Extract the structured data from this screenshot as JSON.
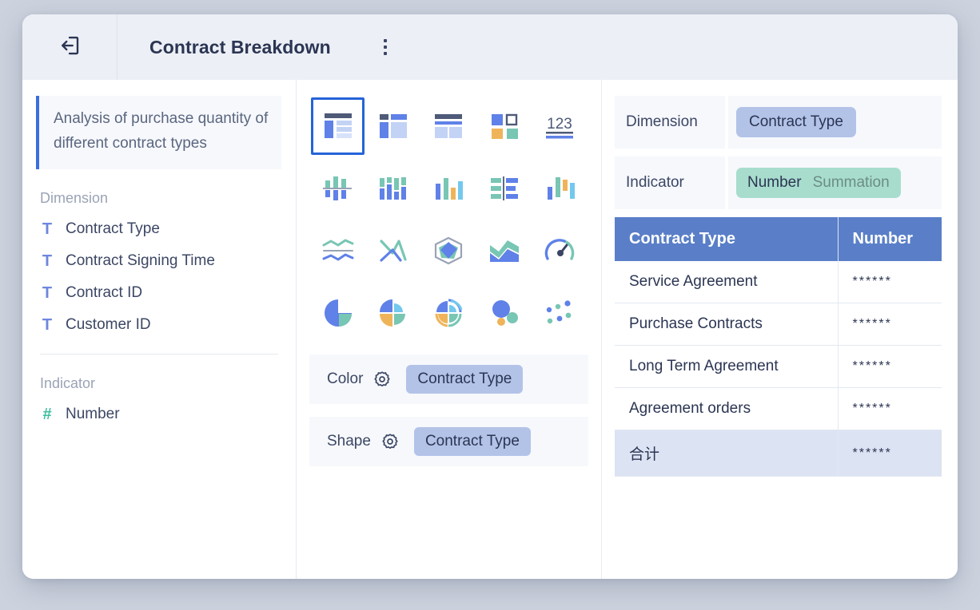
{
  "header": {
    "exit_icon": "exit-arrow-icon",
    "title": "Contract Breakdown",
    "menu_icon": "kebab-menu-icon"
  },
  "sidebar": {
    "description": "Analysis of purchase quantity of different contract types",
    "dimension_group_label": "Dimension",
    "dimension_fields": [
      {
        "icon": "text-type-icon",
        "glyph": "T",
        "label": "Contract Type"
      },
      {
        "icon": "text-type-icon",
        "glyph": "T",
        "label": "Contract Signing Time"
      },
      {
        "icon": "text-type-icon",
        "glyph": "T",
        "label": "Contract ID"
      },
      {
        "icon": "text-type-icon",
        "glyph": "T",
        "label": "Customer ID"
      }
    ],
    "indicator_group_label": "Indicator",
    "indicator_fields": [
      {
        "icon": "number-type-icon",
        "glyph": "#",
        "label": "Number"
      }
    ]
  },
  "chart_types": [
    {
      "name": "table-chart-icon",
      "selected": true
    },
    {
      "name": "pivot-table-chart-icon",
      "selected": false
    },
    {
      "name": "cross-table-chart-icon",
      "selected": false
    },
    {
      "name": "card-tile-chart-icon",
      "selected": false
    },
    {
      "name": "number-123-chart-icon",
      "selected": false
    },
    {
      "name": "bidirectional-bar-chart-icon",
      "selected": false
    },
    {
      "name": "waterfall-bar-chart-icon",
      "selected": false
    },
    {
      "name": "column-chart-icon",
      "selected": false
    },
    {
      "name": "horizontal-bar-chart-icon",
      "selected": false
    },
    {
      "name": "floating-bar-chart-icon",
      "selected": false
    },
    {
      "name": "multi-line-chart-icon",
      "selected": false
    },
    {
      "name": "dual-axis-line-chart-icon",
      "selected": false
    },
    {
      "name": "radar-chart-icon",
      "selected": false
    },
    {
      "name": "area-chart-icon",
      "selected": false
    },
    {
      "name": "gauge-chart-icon",
      "selected": false
    },
    {
      "name": "pie-chart-icon",
      "selected": false
    },
    {
      "name": "donut-segment-chart-icon",
      "selected": false
    },
    {
      "name": "rose-polar-chart-icon",
      "selected": false
    },
    {
      "name": "bubble-chart-icon",
      "selected": false
    },
    {
      "name": "scatter-chart-icon",
      "selected": false
    }
  ],
  "encodings": [
    {
      "label": "Color",
      "gear_icon": "gear-icon",
      "value": "Contract Type"
    },
    {
      "label": "Shape",
      "gear_icon": "gear-icon",
      "value": "Contract Type"
    }
  ],
  "slots": {
    "dimension": {
      "label": "Dimension",
      "value": "Contract Type"
    },
    "indicator": {
      "label": "Indicator",
      "value": "Number",
      "aggregation": "Summation"
    }
  },
  "chart_data": {
    "type": "table",
    "title": "Contract Breakdown",
    "columns": [
      "Contract Type",
      "Number"
    ],
    "categories": [
      "Service Agreement",
      "Purchase Contracts",
      "Long Term Agreement",
      "Agreement orders"
    ],
    "values": [
      "******",
      "******",
      "******",
      "******"
    ],
    "rows": [
      {
        "label": "Service Agreement",
        "number": "******",
        "total": false
      },
      {
        "label": "Purchase Contracts",
        "number": "******",
        "total": false
      },
      {
        "label": "Long Term Agreement",
        "number": "******",
        "total": false
      },
      {
        "label": "Agreement orders",
        "number": "******",
        "total": false
      },
      {
        "label": "合计",
        "number": "******",
        "total": true
      }
    ],
    "masked": true,
    "xlabel": "Contract Type",
    "ylabel": "Number",
    "legend": []
  },
  "colors": {
    "accent_blue": "#2563d9",
    "pill_blue": "#b3c3e8",
    "pill_teal": "#a8ddcd",
    "table_header": "#5a7fc8",
    "total_row": "#dce3f3",
    "panel_bg": "#f6f8fc",
    "text_dark": "#2b3553",
    "text_muted": "#9aa3b5"
  }
}
